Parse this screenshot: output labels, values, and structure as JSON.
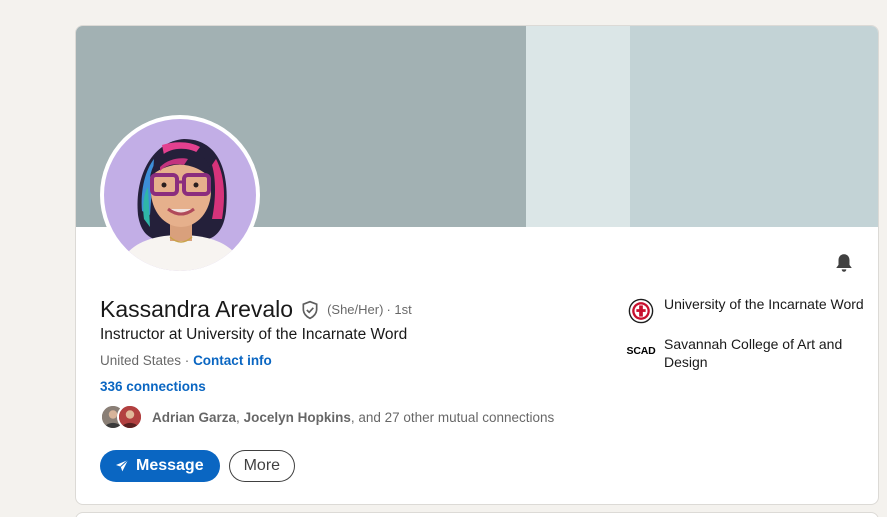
{
  "profile": {
    "name": "Kassandra Arevalo",
    "pronouns": "(She/Her)",
    "degree": "· 1st",
    "headline": "Instructor at University of the Incarnate Word",
    "location": "United States ·",
    "contact_info": "Contact info",
    "connections": "336 connections"
  },
  "mutual": {
    "name1": "Adrian Garza",
    "separator": ",",
    "name2": "Jocelyn Hopkins",
    "rest": ", and 27 other mutual connections"
  },
  "actions": {
    "message_label": "Message",
    "more_label": "More"
  },
  "education": [
    {
      "name": "University of the Incarnate Word",
      "logo": "uiw-seal-icon"
    },
    {
      "name": "Savannah College of Art and Design",
      "logo_text": "SCAD"
    }
  ],
  "icons": {
    "verified": "verified-shield-icon",
    "bell": "bell-icon",
    "send": "send-icon"
  },
  "colors": {
    "accent": "#0a66c2",
    "banner_light": "#c3d3d6",
    "banner_dark": "#a2b1b3",
    "page_bg": "#f4f2ee"
  }
}
